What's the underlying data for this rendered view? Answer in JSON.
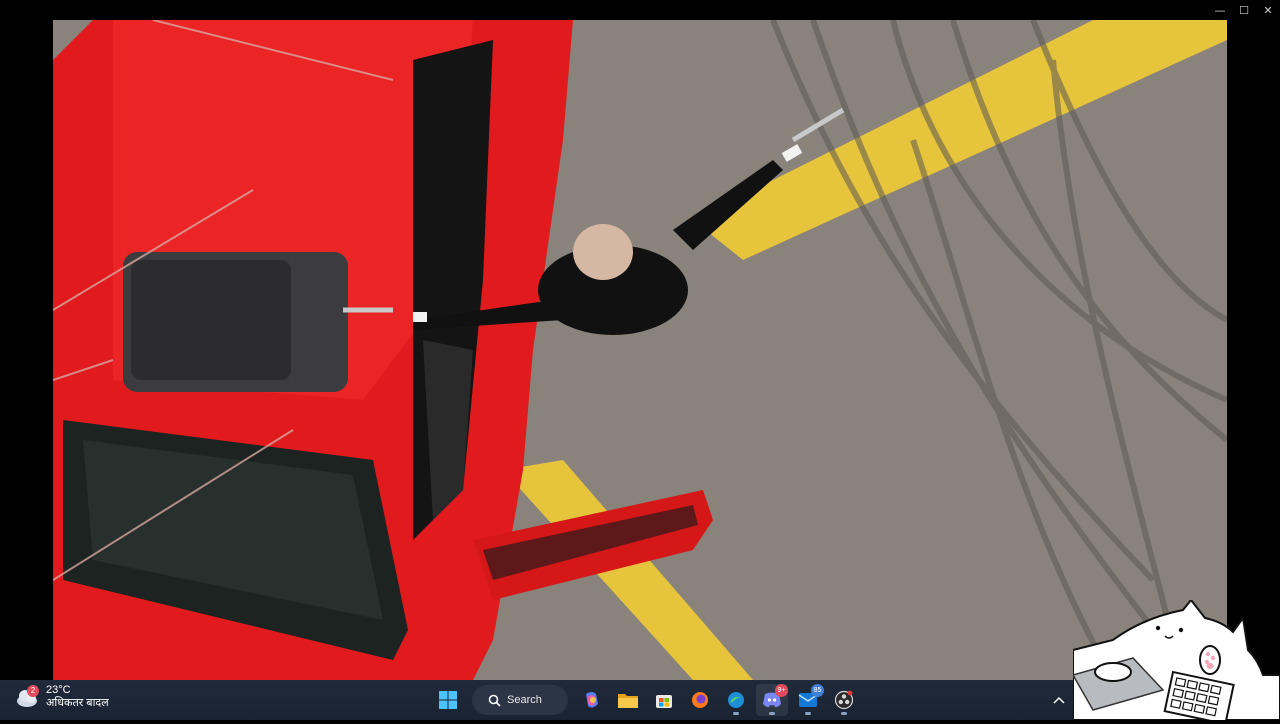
{
  "window": {
    "minimize_glyph": "—",
    "maximize_glyph": "☐",
    "close_glyph": "✕"
  },
  "taskbar": {
    "weather": {
      "temperature": "23°C",
      "condition": "अधिकतर बादल",
      "badge_count": "2",
      "icon": "cloud-icon"
    },
    "search_label": "Search",
    "pinned_apps": [
      {
        "name": "start-button",
        "icon": "windows-logo-icon"
      },
      {
        "name": "copilot",
        "icon": "copilot-icon"
      },
      {
        "name": "file-explorer",
        "icon": "folder-icon"
      },
      {
        "name": "microsoft-store",
        "icon": "store-icon"
      },
      {
        "name": "firefox",
        "icon": "firefox-icon"
      },
      {
        "name": "edge",
        "icon": "edge-icon"
      },
      {
        "name": "discord",
        "icon": "discord-icon",
        "badge": "9+"
      },
      {
        "name": "outlook",
        "icon": "mail-icon",
        "badge": "85"
      },
      {
        "name": "obs",
        "icon": "obs-icon"
      }
    ]
  },
  "colors": {
    "car_red": "#e3171b",
    "road": "#8d877f",
    "lane_yellow": "#e9c43a",
    "taskbar": "#1c2535"
  }
}
